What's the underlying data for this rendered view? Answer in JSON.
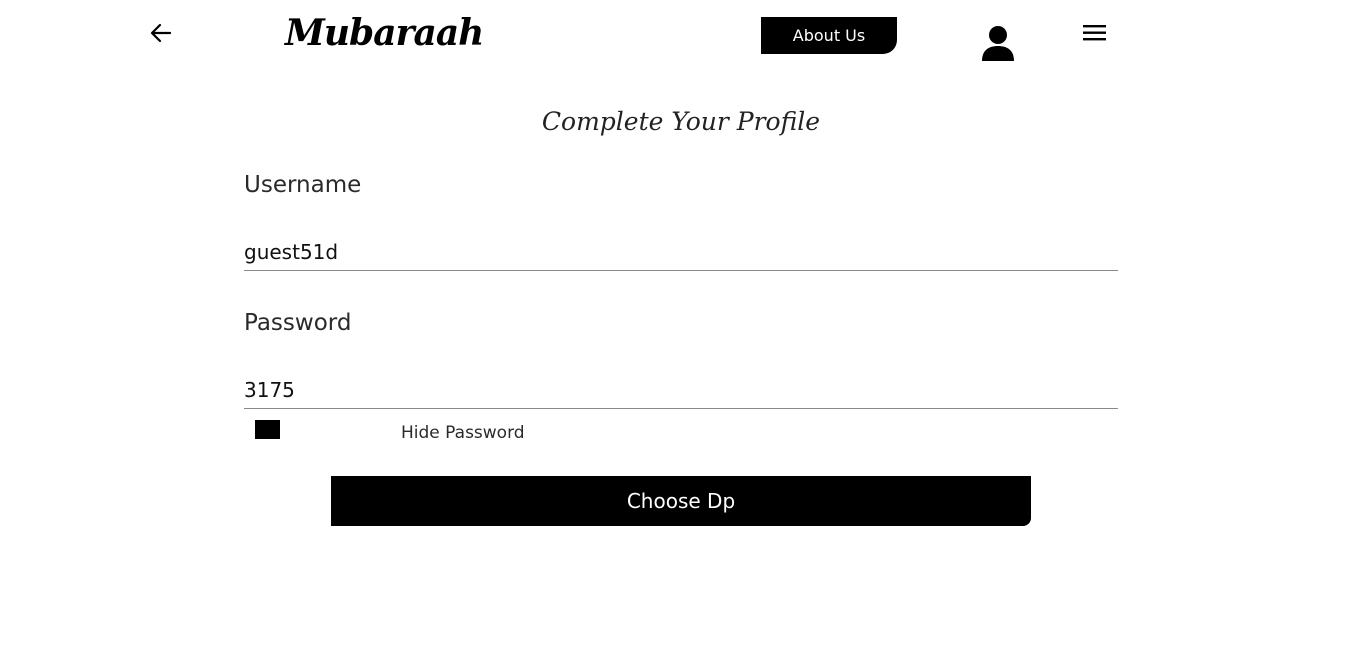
{
  "header": {
    "back_icon": "arrow-left-icon",
    "brand": "Mubaraah",
    "about_label": "About Us",
    "avatar_icon": "user-icon",
    "menu_icon": "hamburger-menu-icon"
  },
  "form": {
    "title": "Complete Your Profile",
    "username": {
      "label": "Username",
      "value": "guest51d"
    },
    "password": {
      "label": "Password",
      "value": "3175"
    },
    "hide_password_label": "Hide Password",
    "choose_dp_label": "Choose Dp"
  },
  "colors": {
    "primary": "#000000",
    "background": "#ffffff",
    "divider": "#8a8a8a"
  }
}
